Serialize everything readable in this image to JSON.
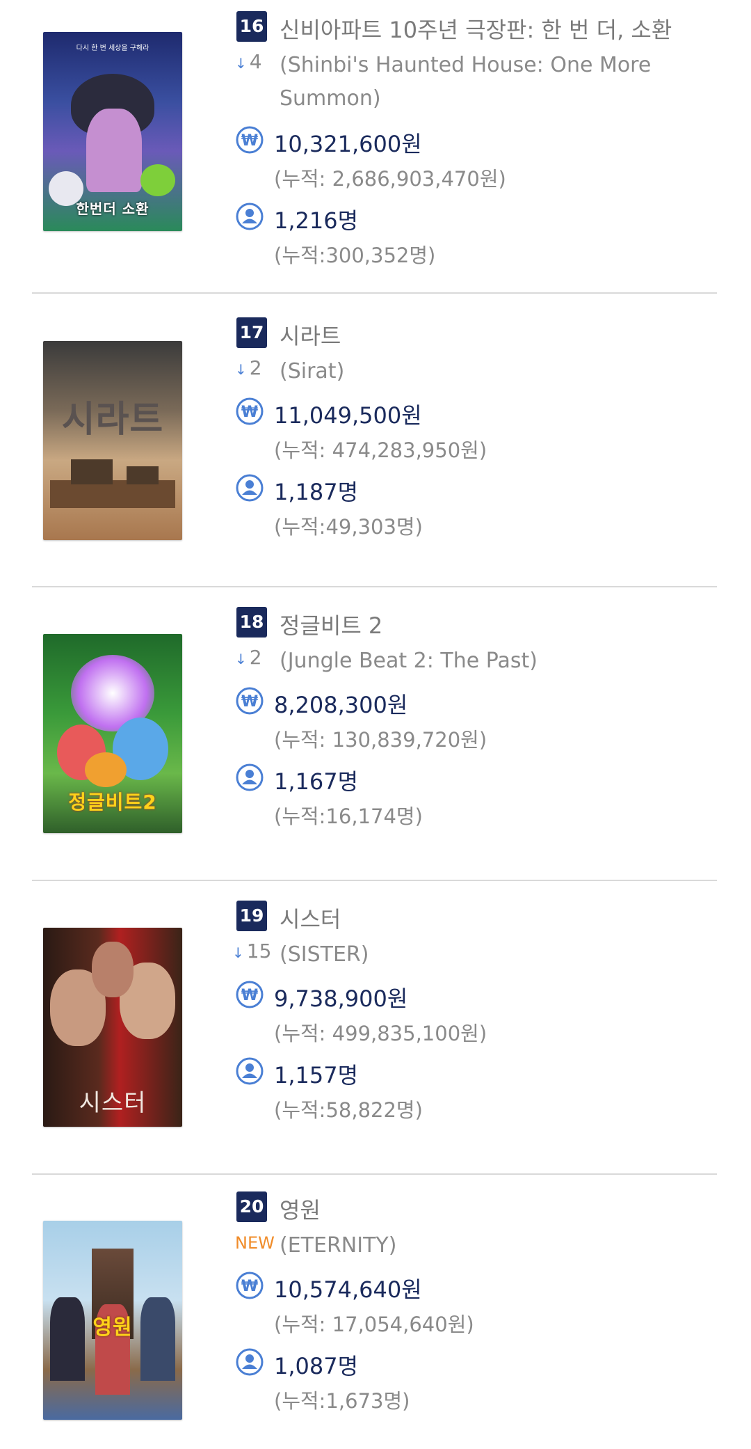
{
  "colors": {
    "rank_badge": "#1a2a5c",
    "value_text": "#1a2a5c",
    "muted_text": "#8a8a8a",
    "icon_blue": "#4a7fd4",
    "new_badge": "#f08c2a",
    "divider": "#d9d9d9"
  },
  "icons": {
    "revenue": "won-currency-icon",
    "audience": "person-icon",
    "rank_down": "arrow-down-icon"
  },
  "movies": [
    {
      "rank": "16",
      "title_ko": "신비아파트 10주년 극장판: 한 번 더, 소환",
      "change": "4",
      "change_type": "down",
      "title_en": "(Shinbi's Haunted House: One More Summon)",
      "revenue": "10,321,600원",
      "revenue_cumulative": "(누적: 2,686,903,470원)",
      "audience": "1,216명",
      "audience_cumulative": "(누적:300,352명)",
      "poster_title": "한번더 소환",
      "poster_tag": "다시 한 번 세상을 구해라"
    },
    {
      "rank": "17",
      "title_ko": "시라트",
      "change": "2",
      "change_type": "down",
      "title_en": "(Sirat)",
      "revenue": "11,049,500원",
      "revenue_cumulative": "(누적: 474,283,950원)",
      "audience": "1,187명",
      "audience_cumulative": "(누적:49,303명)",
      "poster_title": "시라트",
      "poster_tag": ""
    },
    {
      "rank": "18",
      "title_ko": "정글비트 2",
      "change": "2",
      "change_type": "down",
      "title_en": "(Jungle Beat 2: The Past)",
      "revenue": "8,208,300원",
      "revenue_cumulative": "(누적: 130,839,720원)",
      "audience": "1,167명",
      "audience_cumulative": "(누적:16,174명)",
      "poster_title": "정글비트2",
      "poster_tag": ""
    },
    {
      "rank": "19",
      "title_ko": "시스터",
      "change": "15",
      "change_type": "down",
      "title_en": "(SISTER)",
      "revenue": "9,738,900원",
      "revenue_cumulative": "(누적: 499,835,100원)",
      "audience": "1,157명",
      "audience_cumulative": "(누적:58,822명)",
      "poster_title": "시스터",
      "poster_tag": ""
    },
    {
      "rank": "20",
      "title_ko": "영원",
      "change": "NEW",
      "change_type": "new",
      "title_en": "(ETERNITY)",
      "revenue": "10,574,640원",
      "revenue_cumulative": "(누적: 17,054,640원)",
      "audience": "1,087명",
      "audience_cumulative": "(누적:1,673명)",
      "poster_title": "영원",
      "poster_tag": ""
    }
  ]
}
